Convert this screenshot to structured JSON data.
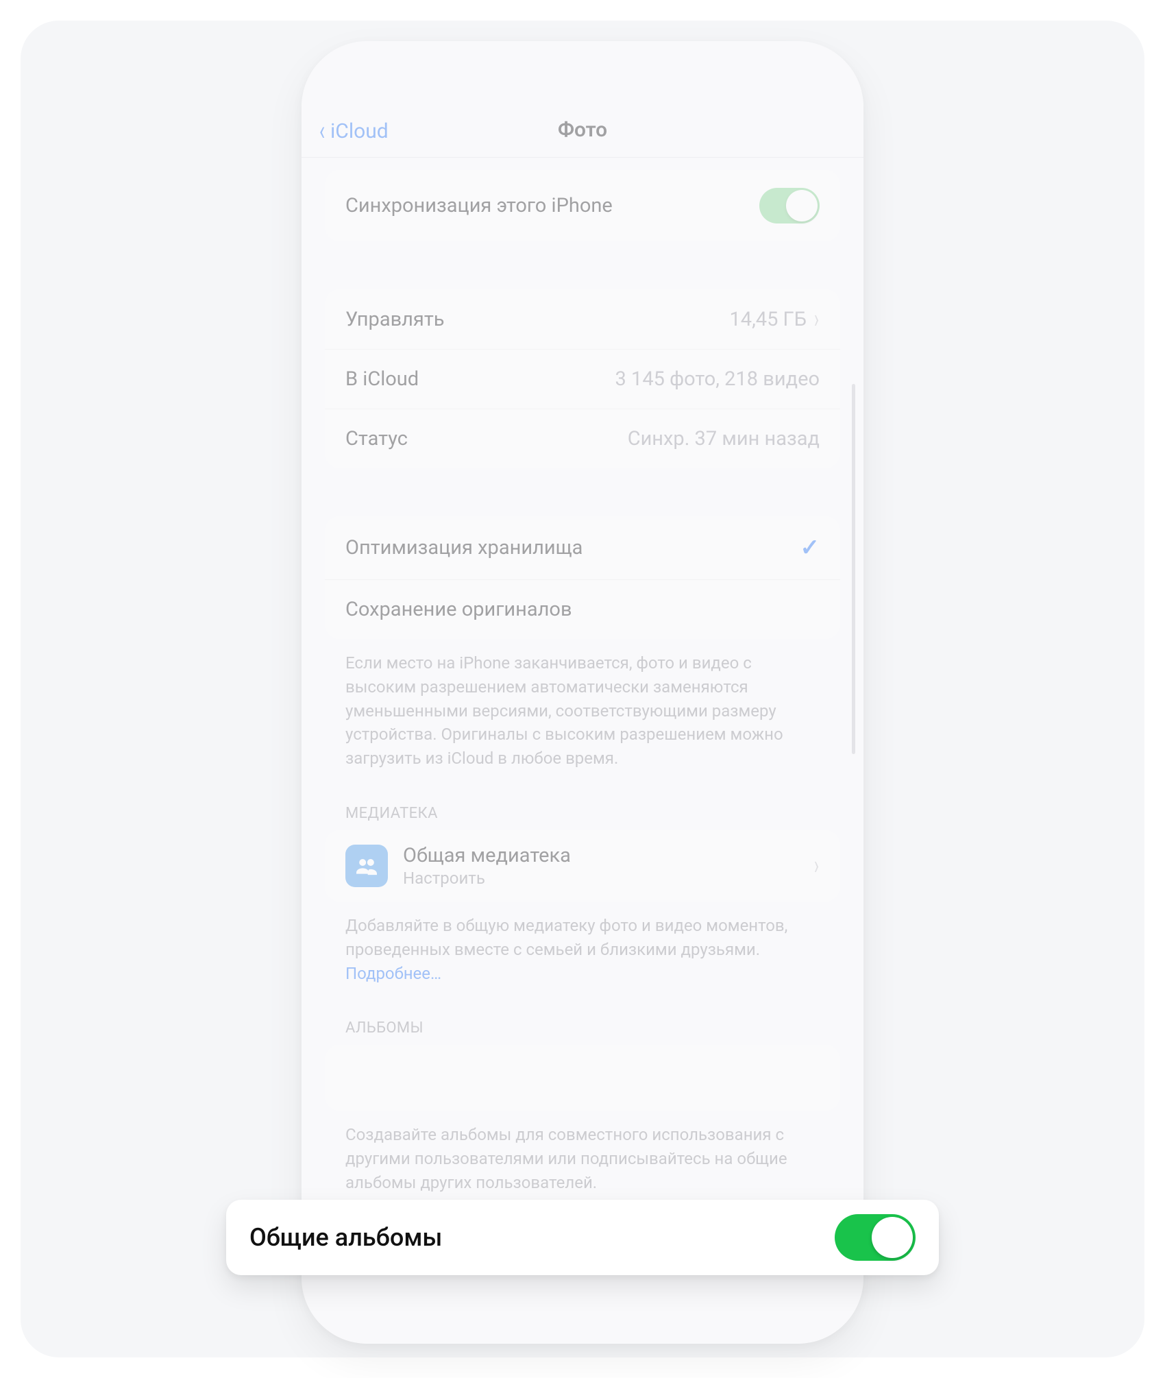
{
  "nav": {
    "back_label": "iCloud",
    "title": "Фото"
  },
  "sync_row": {
    "label": "Синхронизация этого iPhone",
    "on": true
  },
  "storage": {
    "manage_label": "Управлять",
    "manage_value": "14,45 ГБ",
    "icloud_label": "В iCloud",
    "icloud_value": "3 145 фото, 218 видео",
    "status_label": "Статус",
    "status_value": "Синхр. 37 мин назад"
  },
  "optimize": {
    "opt_label": "Оптимизация хранилища",
    "keep_label": "Сохранение оригиналов",
    "footer": "Если место на iPhone заканчивается, фото и видео с высоким разрешением автоматически заменяются уменьшенными версиями, соответствующими размеру устройства. Оригиналы с высоким разрешением можно загрузить из iCloud в любое время."
  },
  "library": {
    "header": "МЕДИАТЕКА",
    "title": "Общая медиатека",
    "subtitle": "Настроить",
    "footer_text": "Добавляйте в общую медиатеку фото и видео моментов, проведенных вместе с семьей и близкими друзьями. ",
    "footer_link": "Подробнее…"
  },
  "albums": {
    "header": "АЛЬБОМЫ",
    "label": "Общие альбомы",
    "footer": "Создавайте альбомы для совместного использования с другими пользователями или подписывайтесь на общие альбомы других пользователей."
  }
}
